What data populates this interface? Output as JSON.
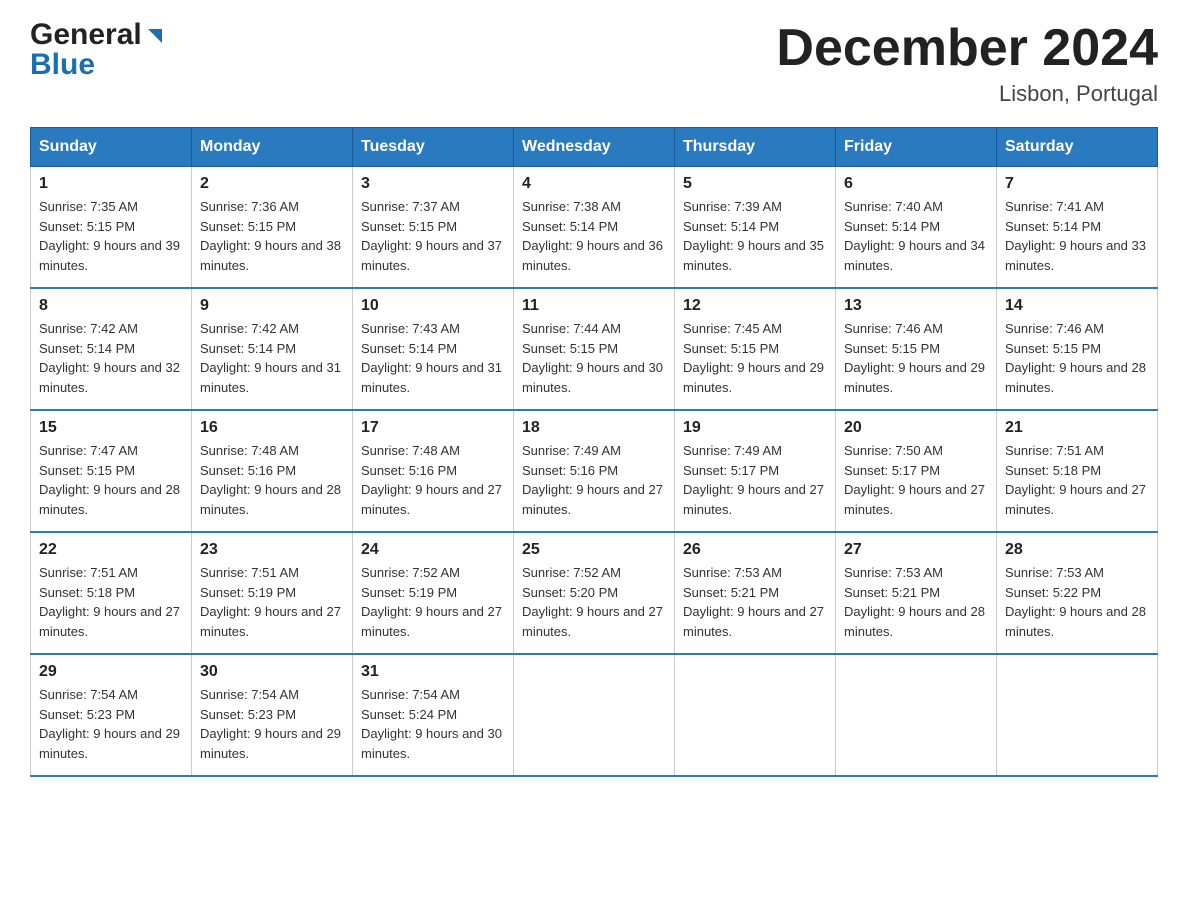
{
  "header": {
    "logo_general": "General",
    "logo_blue": "Blue",
    "month_year": "December 2024",
    "location": "Lisbon, Portugal"
  },
  "days_of_week": [
    "Sunday",
    "Monday",
    "Tuesday",
    "Wednesday",
    "Thursday",
    "Friday",
    "Saturday"
  ],
  "weeks": [
    [
      {
        "day": "1",
        "sunrise": "7:35 AM",
        "sunset": "5:15 PM",
        "daylight": "9 hours and 39 minutes."
      },
      {
        "day": "2",
        "sunrise": "7:36 AM",
        "sunset": "5:15 PM",
        "daylight": "9 hours and 38 minutes."
      },
      {
        "day": "3",
        "sunrise": "7:37 AM",
        "sunset": "5:15 PM",
        "daylight": "9 hours and 37 minutes."
      },
      {
        "day": "4",
        "sunrise": "7:38 AM",
        "sunset": "5:14 PM",
        "daylight": "9 hours and 36 minutes."
      },
      {
        "day": "5",
        "sunrise": "7:39 AM",
        "sunset": "5:14 PM",
        "daylight": "9 hours and 35 minutes."
      },
      {
        "day": "6",
        "sunrise": "7:40 AM",
        "sunset": "5:14 PM",
        "daylight": "9 hours and 34 minutes."
      },
      {
        "day": "7",
        "sunrise": "7:41 AM",
        "sunset": "5:14 PM",
        "daylight": "9 hours and 33 minutes."
      }
    ],
    [
      {
        "day": "8",
        "sunrise": "7:42 AM",
        "sunset": "5:14 PM",
        "daylight": "9 hours and 32 minutes."
      },
      {
        "day": "9",
        "sunrise": "7:42 AM",
        "sunset": "5:14 PM",
        "daylight": "9 hours and 31 minutes."
      },
      {
        "day": "10",
        "sunrise": "7:43 AM",
        "sunset": "5:14 PM",
        "daylight": "9 hours and 31 minutes."
      },
      {
        "day": "11",
        "sunrise": "7:44 AM",
        "sunset": "5:15 PM",
        "daylight": "9 hours and 30 minutes."
      },
      {
        "day": "12",
        "sunrise": "7:45 AM",
        "sunset": "5:15 PM",
        "daylight": "9 hours and 29 minutes."
      },
      {
        "day": "13",
        "sunrise": "7:46 AM",
        "sunset": "5:15 PM",
        "daylight": "9 hours and 29 minutes."
      },
      {
        "day": "14",
        "sunrise": "7:46 AM",
        "sunset": "5:15 PM",
        "daylight": "9 hours and 28 minutes."
      }
    ],
    [
      {
        "day": "15",
        "sunrise": "7:47 AM",
        "sunset": "5:15 PM",
        "daylight": "9 hours and 28 minutes."
      },
      {
        "day": "16",
        "sunrise": "7:48 AM",
        "sunset": "5:16 PM",
        "daylight": "9 hours and 28 minutes."
      },
      {
        "day": "17",
        "sunrise": "7:48 AM",
        "sunset": "5:16 PM",
        "daylight": "9 hours and 27 minutes."
      },
      {
        "day": "18",
        "sunrise": "7:49 AM",
        "sunset": "5:16 PM",
        "daylight": "9 hours and 27 minutes."
      },
      {
        "day": "19",
        "sunrise": "7:49 AM",
        "sunset": "5:17 PM",
        "daylight": "9 hours and 27 minutes."
      },
      {
        "day": "20",
        "sunrise": "7:50 AM",
        "sunset": "5:17 PM",
        "daylight": "9 hours and 27 minutes."
      },
      {
        "day": "21",
        "sunrise": "7:51 AM",
        "sunset": "5:18 PM",
        "daylight": "9 hours and 27 minutes."
      }
    ],
    [
      {
        "day": "22",
        "sunrise": "7:51 AM",
        "sunset": "5:18 PM",
        "daylight": "9 hours and 27 minutes."
      },
      {
        "day": "23",
        "sunrise": "7:51 AM",
        "sunset": "5:19 PM",
        "daylight": "9 hours and 27 minutes."
      },
      {
        "day": "24",
        "sunrise": "7:52 AM",
        "sunset": "5:19 PM",
        "daylight": "9 hours and 27 minutes."
      },
      {
        "day": "25",
        "sunrise": "7:52 AM",
        "sunset": "5:20 PM",
        "daylight": "9 hours and 27 minutes."
      },
      {
        "day": "26",
        "sunrise": "7:53 AM",
        "sunset": "5:21 PM",
        "daylight": "9 hours and 27 minutes."
      },
      {
        "day": "27",
        "sunrise": "7:53 AM",
        "sunset": "5:21 PM",
        "daylight": "9 hours and 28 minutes."
      },
      {
        "day": "28",
        "sunrise": "7:53 AM",
        "sunset": "5:22 PM",
        "daylight": "9 hours and 28 minutes."
      }
    ],
    [
      {
        "day": "29",
        "sunrise": "7:54 AM",
        "sunset": "5:23 PM",
        "daylight": "9 hours and 29 minutes."
      },
      {
        "day": "30",
        "sunrise": "7:54 AM",
        "sunset": "5:23 PM",
        "daylight": "9 hours and 29 minutes."
      },
      {
        "day": "31",
        "sunrise": "7:54 AM",
        "sunset": "5:24 PM",
        "daylight": "9 hours and 30 minutes."
      },
      null,
      null,
      null,
      null
    ]
  ],
  "labels": {
    "sunrise_prefix": "Sunrise: ",
    "sunset_prefix": "Sunset: ",
    "daylight_prefix": "Daylight: "
  }
}
